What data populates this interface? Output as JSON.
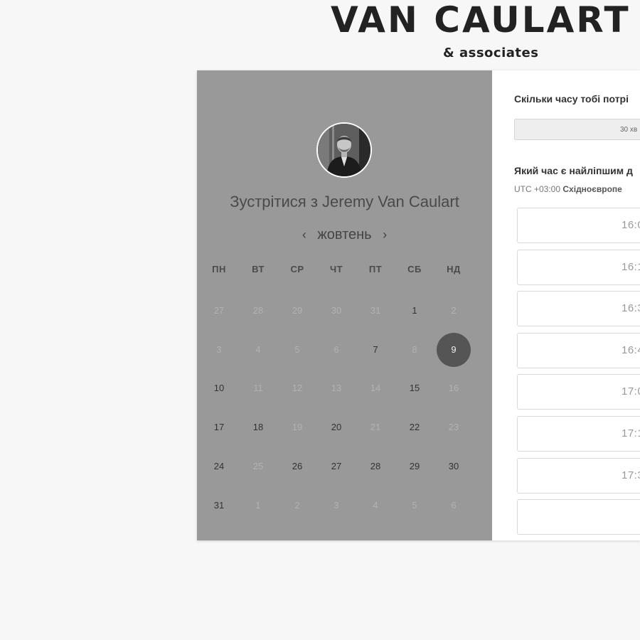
{
  "brand": {
    "name": "VAN CAULART",
    "sub": "& associates"
  },
  "meeting": {
    "title_prefix": "Зустрітися з ",
    "host": "Jeremy Van Caulart"
  },
  "calendar": {
    "month": "жовтень",
    "prev_icon": "chevron-left-icon",
    "next_icon": "chevron-right-icon",
    "weekdays": [
      "ПН",
      "ВТ",
      "СР",
      "ЧТ",
      "ПТ",
      "СБ",
      "НД"
    ],
    "weeks": [
      [
        {
          "d": "27",
          "s": "muted"
        },
        {
          "d": "28",
          "s": "muted"
        },
        {
          "d": "29",
          "s": "muted"
        },
        {
          "d": "30",
          "s": "muted"
        },
        {
          "d": "31",
          "s": "muted"
        },
        {
          "d": "1",
          "s": "avail"
        },
        {
          "d": "2",
          "s": "muted"
        }
      ],
      [
        {
          "d": "3",
          "s": "muted"
        },
        {
          "d": "4",
          "s": "muted"
        },
        {
          "d": "5",
          "s": "muted"
        },
        {
          "d": "6",
          "s": "muted"
        },
        {
          "d": "7",
          "s": "avail"
        },
        {
          "d": "8",
          "s": "muted"
        },
        {
          "d": "9",
          "s": "selected"
        }
      ],
      [
        {
          "d": "10",
          "s": "avail"
        },
        {
          "d": "11",
          "s": "muted"
        },
        {
          "d": "12",
          "s": "muted"
        },
        {
          "d": "13",
          "s": "muted"
        },
        {
          "d": "14",
          "s": "muted"
        },
        {
          "d": "15",
          "s": "avail"
        },
        {
          "d": "16",
          "s": "muted"
        }
      ],
      [
        {
          "d": "17",
          "s": "avail"
        },
        {
          "d": "18",
          "s": "avail"
        },
        {
          "d": "19",
          "s": "muted"
        },
        {
          "d": "20",
          "s": "avail"
        },
        {
          "d": "21",
          "s": "muted"
        },
        {
          "d": "22",
          "s": "avail"
        },
        {
          "d": "23",
          "s": "muted"
        }
      ],
      [
        {
          "d": "24",
          "s": "avail"
        },
        {
          "d": "25",
          "s": "muted"
        },
        {
          "d": "26",
          "s": "avail"
        },
        {
          "d": "27",
          "s": "avail"
        },
        {
          "d": "28",
          "s": "avail"
        },
        {
          "d": "29",
          "s": "avail"
        },
        {
          "d": "30",
          "s": "avail"
        }
      ],
      [
        {
          "d": "31",
          "s": "avail"
        },
        {
          "d": "1",
          "s": "muted"
        },
        {
          "d": "2",
          "s": "muted"
        },
        {
          "d": "3",
          "s": "muted"
        },
        {
          "d": "4",
          "s": "muted"
        },
        {
          "d": "5",
          "s": "muted"
        },
        {
          "d": "6",
          "s": "muted"
        }
      ]
    ],
    "selected_day": "9"
  },
  "booking": {
    "duration_question": "Скільки часу тобі потрі",
    "duration_value": "30 хв",
    "time_question": "Який час є найліпшим д",
    "tz_offset": "UTC +03:00",
    "tz_name": "Східноєвропе",
    "slots": [
      "16:0",
      "16:1",
      "16:3",
      "16:4",
      "17:0",
      "17:1",
      "17:3",
      ""
    ]
  },
  "colors": {
    "left_panel": "#999999",
    "selected_day": "#555555",
    "page_bg": "#f7f7f7"
  }
}
